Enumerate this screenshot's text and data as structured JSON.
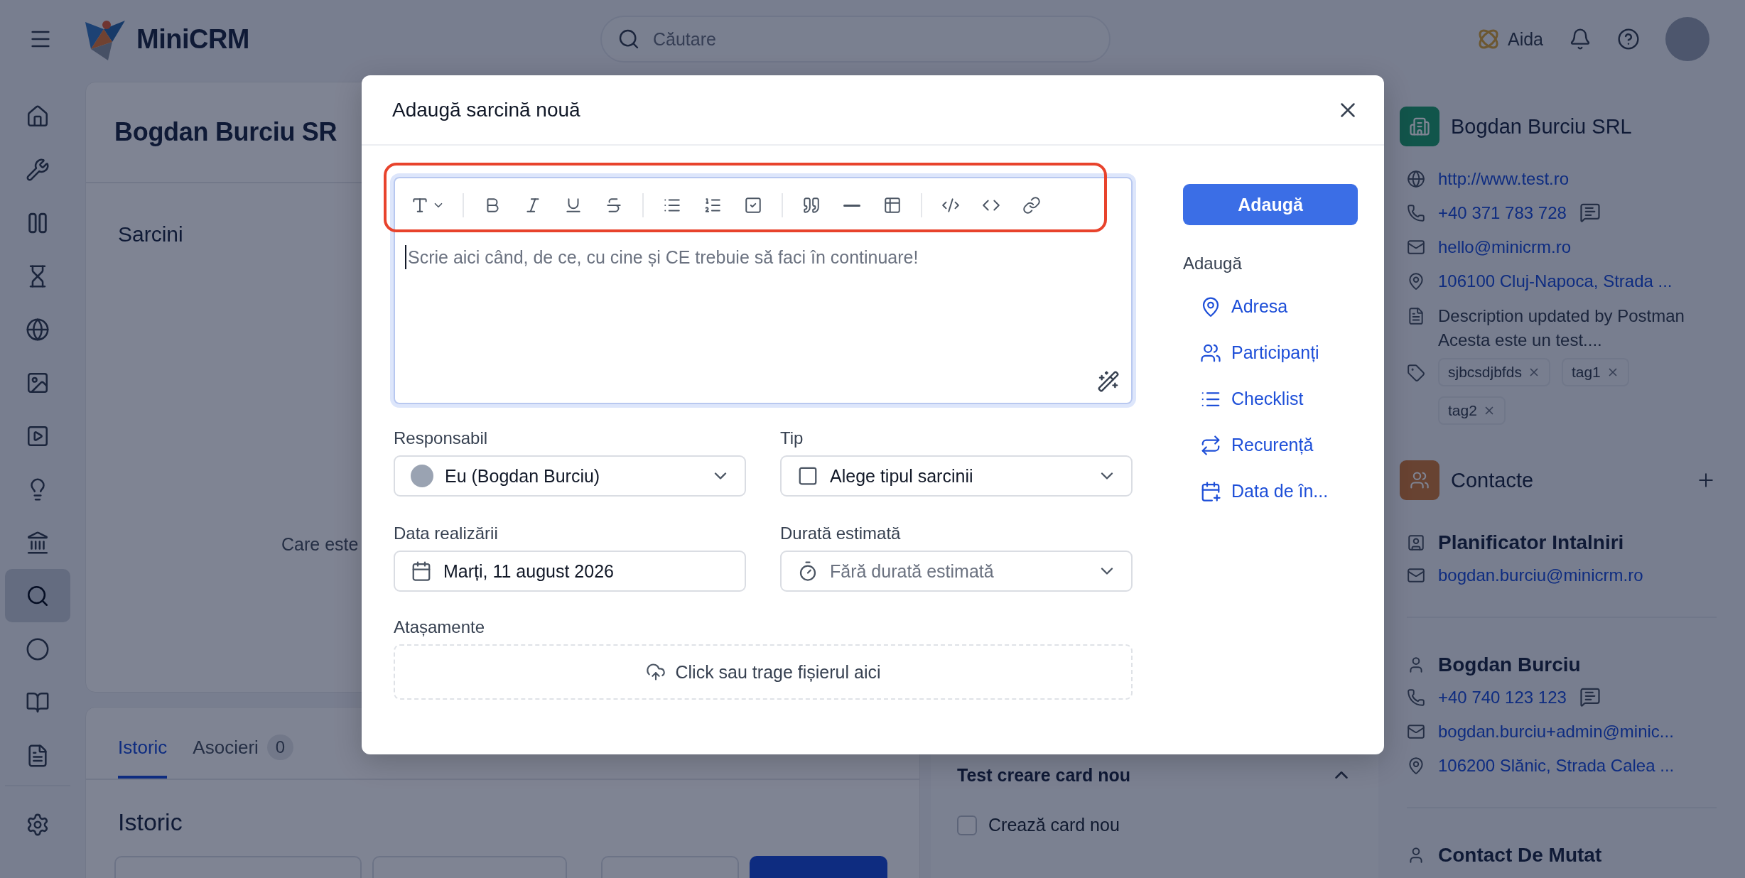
{
  "topbar": {
    "logo": "MiniCRM",
    "search": {
      "placeholder": "Căutare"
    },
    "assistant": "Aida"
  },
  "sidebar": {
    "items": [
      {
        "kind": "home",
        "selected": false
      },
      {
        "kind": "tools",
        "selected": false
      },
      {
        "kind": "boards",
        "selected": false
      },
      {
        "kind": "hourglass",
        "selected": false
      },
      {
        "kind": "globe",
        "selected": false
      },
      {
        "kind": "image",
        "selected": false
      },
      {
        "kind": "video",
        "selected": false
      },
      {
        "kind": "idea",
        "selected": false
      },
      {
        "kind": "bank",
        "selected": false
      },
      {
        "kind": "search",
        "selected": true
      },
      {
        "kind": "circle",
        "selected": false
      },
      {
        "kind": "book",
        "selected": false
      },
      {
        "kind": "document",
        "selected": false
      }
    ],
    "footer_item": {
      "kind": "settings",
      "selected": false
    }
  },
  "main": {
    "title": "Bogdan Burciu SR",
    "section": "Sarcini",
    "empty_text": "Care este",
    "tabs": [
      {
        "label": "Istoric",
        "selected": true
      },
      {
        "label": "Asocieri",
        "count": "0",
        "selected": false
      }
    ],
    "history_title": "Istoric"
  },
  "side_card": {
    "title": "Test creare card nou",
    "expanded": true,
    "checkbox": {
      "label": "Crează card nou",
      "checked": false
    }
  },
  "company": {
    "name": "Bogdan Burciu SRL",
    "website": "http://www.test.ro",
    "phone": "+40 371 783 728",
    "email": "hello@minicrm.ro",
    "address": "106100 Cluj-Napoca, Strada ...",
    "description": "Description updated by Postman Acesta este un test....",
    "tags": [
      "sjbcsdjbfds",
      "tag1",
      "tag2"
    ]
  },
  "contacts": {
    "title": "Contacte",
    "items": [
      {
        "kind": "planner",
        "name": "Planificator Intalniri",
        "email": "bogdan.burciu@minicrm.ro"
      },
      {
        "kind": "person",
        "name": "Bogdan Burciu",
        "phone": "+40 740 123 123",
        "email": "bogdan.burciu+admin@minic...",
        "address": "106200 Slănic, Strada Calea ..."
      },
      {
        "kind": "person",
        "name": "Contact De Mutat"
      }
    ]
  },
  "modal": {
    "title": "Adaugă sarcină nouă",
    "editor": {
      "placeholder": "Scrie aici când, de ce, cu cine și CE trebuie să faci în continuare!",
      "highlighted": true
    },
    "fields": [
      {
        "kind": "user",
        "label": "Responsabil",
        "value": "Eu (Bogdan Burciu)"
      },
      {
        "kind": "type",
        "label": "Tip",
        "value": "Alege tipul sarcinii"
      },
      {
        "kind": "date",
        "label": "Data realizării",
        "value": "Marți, 11 august 2026"
      },
      {
        "kind": "duration",
        "label": "Durată estimată",
        "placeholder": "Fără durată estimată"
      }
    ],
    "attachments": {
      "label": "Atașamente",
      "dropzone": "Click sau trage fișierul aici"
    },
    "submit": "Adaugă",
    "extras_title": "Adaugă",
    "extras": [
      {
        "kind": "address",
        "label": "Adresa"
      },
      {
        "kind": "participants",
        "label": "Participanți"
      },
      {
        "kind": "checklist",
        "label": "Checklist"
      },
      {
        "kind": "recurrence",
        "label": "Recurență"
      },
      {
        "kind": "start_date",
        "label": "Data de în..."
      }
    ]
  }
}
